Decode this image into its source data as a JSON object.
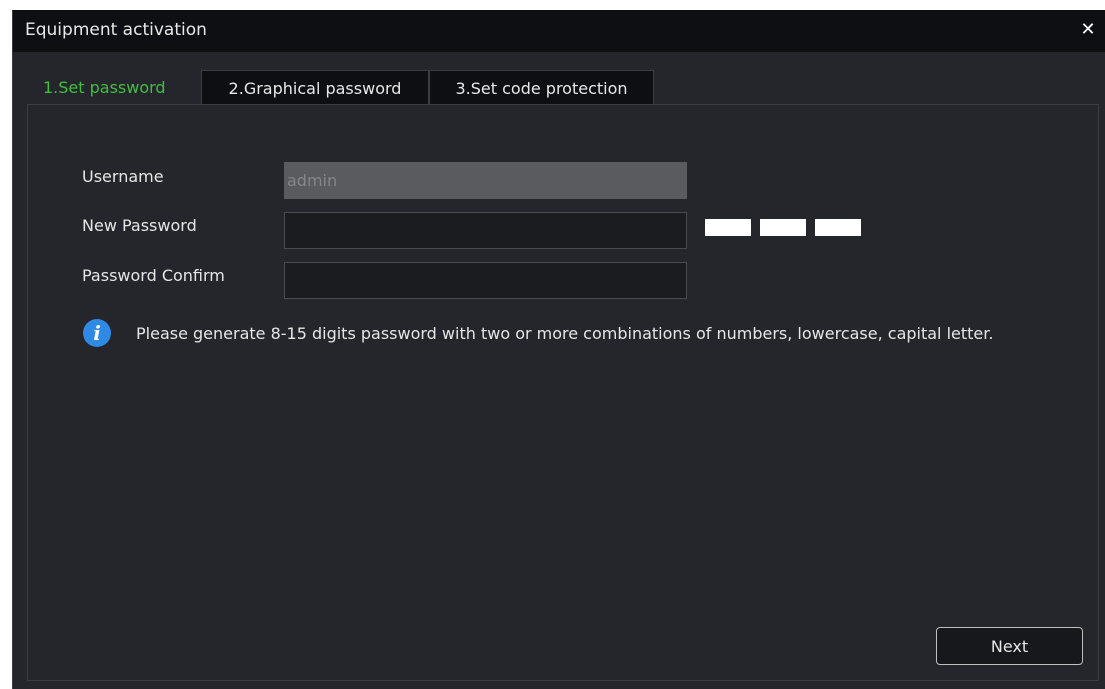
{
  "dialog": {
    "title": "Equipment activation",
    "close_symbol": "✕"
  },
  "tabs": [
    {
      "label": "1.Set password",
      "active": true
    },
    {
      "label": "2.Graphical password",
      "active": false
    },
    {
      "label": "3.Set code protection",
      "active": false
    }
  ],
  "form": {
    "username": {
      "label": "Username",
      "value": "admin"
    },
    "new_password": {
      "label": "New Password",
      "value": ""
    },
    "password_confirm": {
      "label": "Password Confirm",
      "value": ""
    }
  },
  "strength_segments": 3,
  "hint": {
    "icon": "info-icon",
    "icon_glyph": "i",
    "text": "Please generate 8-15 digits password with two or more combinations of numbers, lowercase, capital letter."
  },
  "buttons": {
    "next_label": "Next"
  },
  "colors": {
    "active_tab": "#3fbf3f",
    "info_icon": "#2f8ae6",
    "background": "#25262b",
    "titlebar": "#0e0f12"
  }
}
